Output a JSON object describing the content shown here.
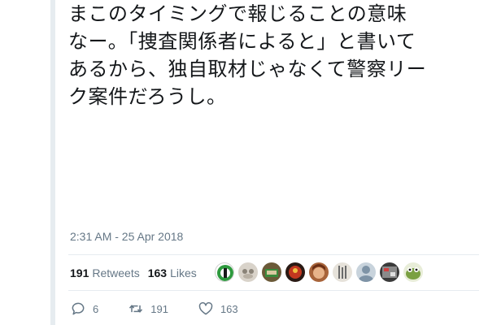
{
  "tweet": {
    "lines": [
      "まこのタイミングで報じることの意味",
      "なー。「捜査関係者によると」と書いて",
      "あるから、独自取材じゃなくて警察リー",
      "ク案件だろうし。"
    ],
    "timestamp": "2:31 AM - 25 Apr 2018"
  },
  "stats": {
    "retweets_count": "191",
    "retweets_label": "Retweets",
    "likes_count": "163",
    "likes_label": "Likes"
  },
  "avatars": [
    {
      "name": "avatar-1",
      "color": "#2a8a3a"
    },
    {
      "name": "avatar-2",
      "color": "#c9c2b8"
    },
    {
      "name": "avatar-3",
      "color": "#5b4a2e"
    },
    {
      "name": "avatar-4",
      "color": "#b3321f"
    },
    {
      "name": "avatar-5",
      "color": "#8a4a2a"
    },
    {
      "name": "avatar-6",
      "color": "#d8d4cc"
    },
    {
      "name": "avatar-7",
      "color": "#8ea3b5"
    },
    {
      "name": "avatar-8",
      "color": "#4a4a4a"
    },
    {
      "name": "avatar-9",
      "color": "#7fa04a"
    }
  ],
  "actions": {
    "reply_icon": "reply-icon",
    "reply_count": "6",
    "retweet_icon": "retweet-icon",
    "retweet_count": "191",
    "like_icon": "heart-icon",
    "like_count": "163"
  }
}
